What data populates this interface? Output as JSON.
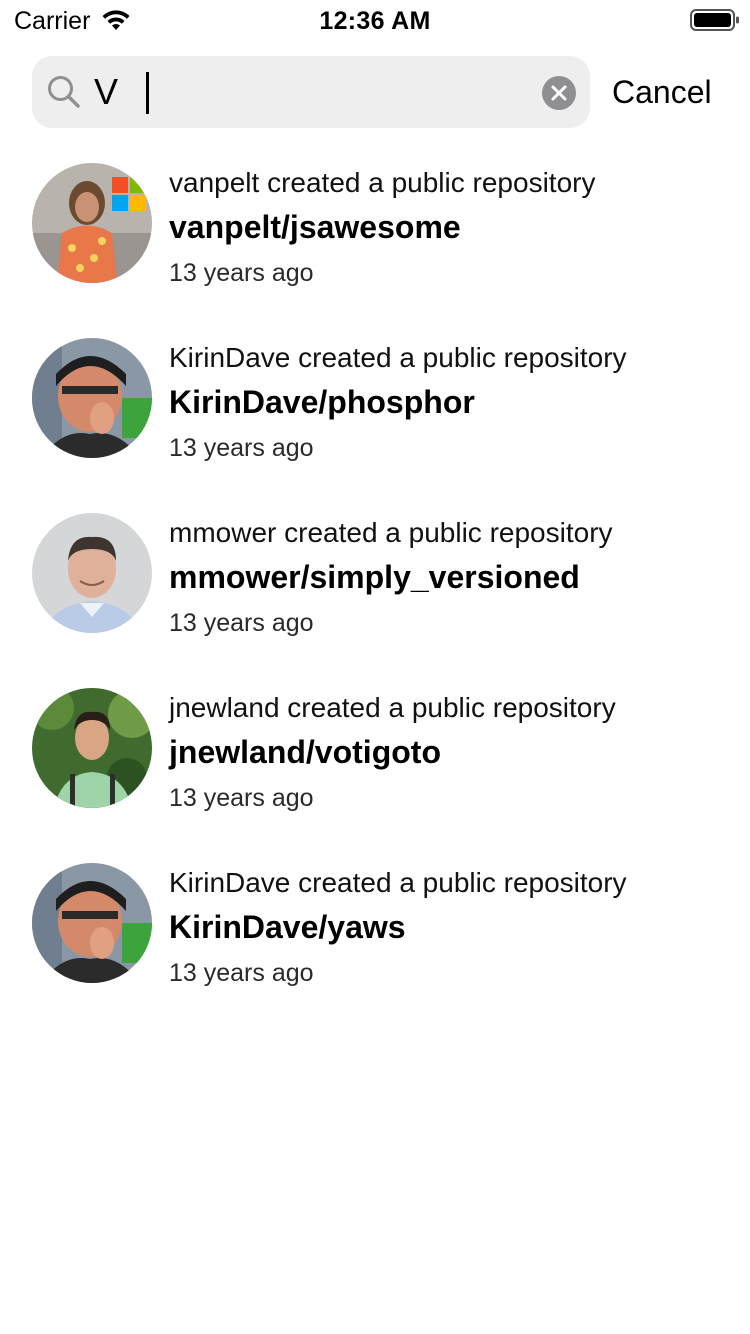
{
  "status_bar": {
    "carrier": "Carrier",
    "time": "12:36 AM",
    "wifi_icon": "wifi-icon",
    "battery_icon": "battery-full-icon"
  },
  "search": {
    "value": "V",
    "icon": "search-icon",
    "clear_icon": "clear-icon",
    "cancel_label": "Cancel"
  },
  "results": [
    {
      "action": "vanpelt created a public repository",
      "repo": "vanpelt/jsawesome",
      "time": "13 years ago",
      "avatar": "avatar-vanpelt"
    },
    {
      "action": "KirinDave created a public repository",
      "repo": "KirinDave/phosphor",
      "time": "13 years ago",
      "avatar": "avatar-kirindave"
    },
    {
      "action": "mmower created a public repository",
      "repo": "mmower/simply_versioned",
      "time": "13 years ago",
      "avatar": "avatar-mmower"
    },
    {
      "action": "jnewland created a public repository",
      "repo": "jnewland/votigoto",
      "time": "13 years ago",
      "avatar": "avatar-jnewland"
    },
    {
      "action": "KirinDave created a public repository",
      "repo": "KirinDave/yaws",
      "time": "13 years ago",
      "avatar": "avatar-kirindave"
    }
  ],
  "colors": {
    "search_background": "#eeeeef",
    "clear_button": "#8e8e93",
    "text": "#000000"
  }
}
